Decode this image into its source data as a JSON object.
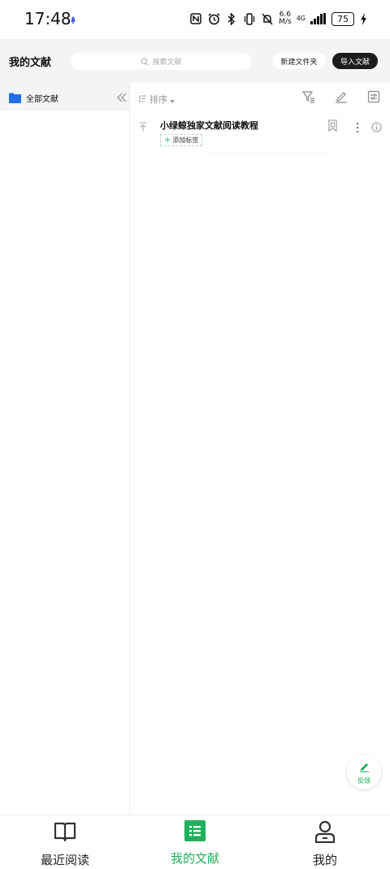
{
  "status_bar": {
    "time": "17:48",
    "notification_icon": "notification-icon",
    "network_speed_value": "6.6",
    "network_speed_unit": "M/s",
    "network_type": "4G",
    "battery": "75",
    "icons": [
      "nfc-icon",
      "alarm-icon",
      "bluetooth-icon",
      "vibrate-icon",
      "mute-icon",
      "signal-icon",
      "battery-icon",
      "charging-icon"
    ]
  },
  "header": {
    "title": "我的文献",
    "search_placeholder": "搜索文献",
    "new_folder_label": "新建文件夹",
    "import_label": "导入文献"
  },
  "sidebar": {
    "folders": [
      {
        "label": "全部文献",
        "icon": "folder-icon",
        "color": "#1f6fe5"
      }
    ]
  },
  "toolbar": {
    "sort_label": "排序",
    "icons": [
      "filter-icon",
      "edit-icon",
      "settings-icon"
    ]
  },
  "documents": [
    {
      "title": "小绿鲸独家文献阅读教程",
      "add_tag_label": "添加标签"
    }
  ],
  "feedback": {
    "label": "反馈"
  },
  "bottom_nav": {
    "items": [
      {
        "label": "最近阅读",
        "icon": "book-icon",
        "active": false
      },
      {
        "label": "我的文献",
        "icon": "list-icon",
        "active": true
      },
      {
        "label": "我的",
        "icon": "person-icon",
        "active": false
      }
    ]
  },
  "colors": {
    "accent": "#20b05c",
    "folder": "#1f6fe5",
    "header_bg": "#f3f4f6",
    "dark_button": "#1c1c1c"
  }
}
